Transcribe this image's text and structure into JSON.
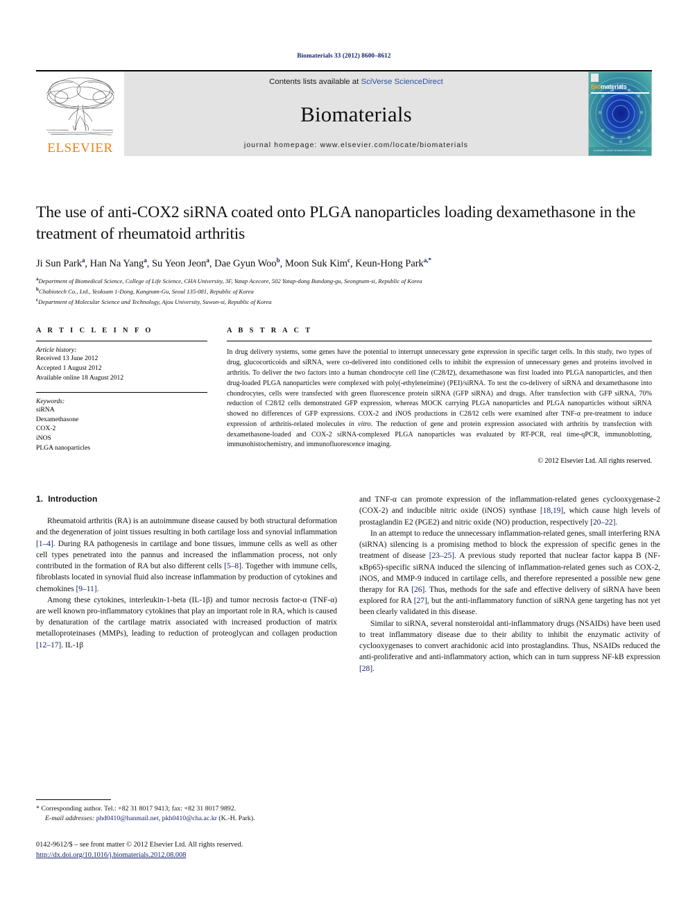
{
  "running_head": "Biomaterials 33 (2012) 8600–8612",
  "masthead": {
    "contents_prefix": "Contents lists available at ",
    "contents_link": "SciVerse ScienceDirect",
    "journal_name": "Biomaterials",
    "homepage": "journal homepage: www.elsevier.com/locate/biomaterials",
    "publisher_logo_text": "ELSEVIER",
    "cover_title_prefix": "Bio",
    "cover_title_suffix": "materials",
    "cover_footer": "Available online at www.sciencedirect.com"
  },
  "article": {
    "title": "The use of anti-COX2 siRNA coated onto PLGA nanoparticles loading dexamethasone in the treatment of rheumatoid arthritis",
    "authors_plain": "Ji Sun Park a, Han Na Yang a, Su Yeon Jeon a, Dae Gyun Woo b, Moon Suk Kim c, Keun-Hong Park a,*",
    "authors": [
      {
        "name": "Ji Sun Park",
        "marks": "a",
        "sep": ", "
      },
      {
        "name": "Han Na Yang",
        "marks": "a",
        "sep": ", "
      },
      {
        "name": "Su Yeon Jeon",
        "marks": "a",
        "sep": ", "
      },
      {
        "name": "Dae Gyun Woo",
        "marks": "b",
        "sep": ", "
      },
      {
        "name": "Moon Suk Kim",
        "marks": "c",
        "sep": ", "
      },
      {
        "name": "Keun-Hong Park",
        "marks": "a,*",
        "sep": ""
      }
    ],
    "affiliations": [
      {
        "mark": "a",
        "text": "Department of Biomedical Science, College of Life Science, CHA University, 3F, Yatap Acecore, 502 Yatap-dong Bundang-gu, Seongnam-si, Republic of Korea"
      },
      {
        "mark": "b",
        "text": "Chabiotech Co., Ltd., Yeoksam 1-Dong, Kangnam-Gu, Seoul 135-081, Republic of Korea"
      },
      {
        "mark": "c",
        "text": "Department of Molecular Science and Technology, Ajou University, Suwon-si, Republic of Korea"
      }
    ]
  },
  "article_info": {
    "heading": "A R T I C L E  I N F O",
    "history_label": "Article history:",
    "history": [
      "Received 13 June 2012",
      "Accepted 1 August 2012",
      "Available online 18 August 2012"
    ],
    "keywords_label": "Keywords:",
    "keywords": [
      "siRNA",
      "Dexamethasone",
      "COX-2",
      "iNOS",
      "PLGA nanoparticles"
    ]
  },
  "abstract": {
    "heading": "A B S T R A C T",
    "paragraph_1": "In drug delivery systems, some genes have the potential to interrupt unnecessary gene expression in specific target cells. In this study, two types of drug, glucocorticoids and siRNA, were co-delivered into conditioned cells to inhibit the expression of unnecessary genes and proteins involved in arthritis. To deliver the two factors into a human chondrocyte cell line (C28/I2), dexamethasone was first loaded into PLGA nanoparticles, and then drug-loaded PLGA nanoparticles were complexed with poly(-ethyleneimine) (PEI)/siRNA. To test the co-delivery of siRNA and dexamethasone into chondrocytes, cells were transfected with green fluorescence protein siRNA (GFP siRNA) and drugs. After transfection with GFP siRNA, 70% reduction of C28/I2 cells demonstrated GFP expression, whereas MOCK carrying PLGA nanoparticles and PLGA nanoparticles without siRNA showed no differences of GFP expressions. COX-2 and iNOS productions in C28/I2 cells were examined after TNF-α pre-treatment to induce expression of arthritis-related molecules ",
    "paragraph_1_italic": "in vitro",
    "paragraph_1_tail": ". The reduction of gene and protein expression associated with arthritis by transfection with dexamethasone-loaded and COX-2 siRNA-complexed PLGA nanoparticles was evaluated by RT-PCR, real time-qPCR, immunoblotting, immunohistochemistry, and immunofluorescence imaging.",
    "copyright": "© 2012 Elsevier Ltd. All rights reserved."
  },
  "introduction": {
    "number": "1.",
    "title": "Introduction",
    "left_paragraphs": [
      "Rheumatoid arthritis (RA) is an autoimmune disease caused by both structural deformation and the degeneration of joint tissues resulting in both cartilage loss and synovial inflammation [1–4]. During RA pathogenesis in cartilage and bone tissues, immune cells as well as other cell types penetrated into the pannus and increased the inflammation process, not only contributed in the formation of RA but also different cells [5–8]. Together with immune cells, fibroblasts located in synovial fluid also increase inflammation by production of cytokines and chemokines [9–11].",
      "Among these cytokines, interleukin-1-beta (IL-1β) and tumor necrosis factor-α (TNF-α) are well known pro-inflammatory cytokines that play an important role in RA, which is caused by denaturation of the cartilage matrix associated with increased production of matrix metalloproteinases (MMPs), leading to reduction of proteoglycan and collagen production [12–17]. IL-1β"
    ],
    "right_paragraphs": [
      "and TNF-α can promote expression of the inflammation-related genes cyclooxygenase-2 (COX-2) and inducible nitric oxide (iNOS) synthase [18,19], which cause high levels of prostaglandin E2 (PGE2) and nitric oxide (NO) production, respectively [20–22].",
      "In an attempt to reduce the unnecessary inflammation-related genes, small interfering RNA (siRNA) silencing is a promising method to block the expression of specific genes in the treatment of disease [23–25]. A previous study reported that nuclear factor kappa B (NF-κBp65)-specific siRNA induced the silencing of inflammation-related genes such as COX-2, iNOS, and MMP-9 induced in cartilage cells, and therefore represented a possible new gene therapy for RA [26]. Thus, methods for the safe and effective delivery of siRNA have been explored for RA [27], but the anti-inflammatory function of siRNA gene targeting has not yet been clearly validated in this disease.",
      "Similar to siRNA, several nonsteroidal anti-inflammatory drugs (NSAIDs) have been used to treat inflammatory disease due to their ability to inhibit the enzymatic activity of cyclooxygenases to convert arachidonic acid into prostaglandins. Thus, NSAIDs reduced the anti-proliferative and anti-inflammatory action, which can in turn suppress NF-kB expression [28]."
    ]
  },
  "footnote": {
    "line1": "* Corresponding author. Tel.: +82 31 8017 9413; fax: +82 31 8017 9892.",
    "email_label": "E-mail addresses:",
    "email1": "phd0410@hanmail.net",
    "email_sep": ", ",
    "email2": "pkh0410@cha.ac.kr",
    "email_owner": " (K.-H. Park)."
  },
  "footer": {
    "issn_line": "0142-9612/$ – see front matter © 2012 Elsevier Ltd. All rights reserved.",
    "doi": "http://dx.doi.org/10.1016/j.biomaterials.2012.08.008"
  },
  "colors": {
    "link": "#13226b",
    "elsevier_orange": "#f07f13",
    "masthead_grey": "#e3e3e3",
    "sciencedirect_blue": "#2b4ea2"
  }
}
